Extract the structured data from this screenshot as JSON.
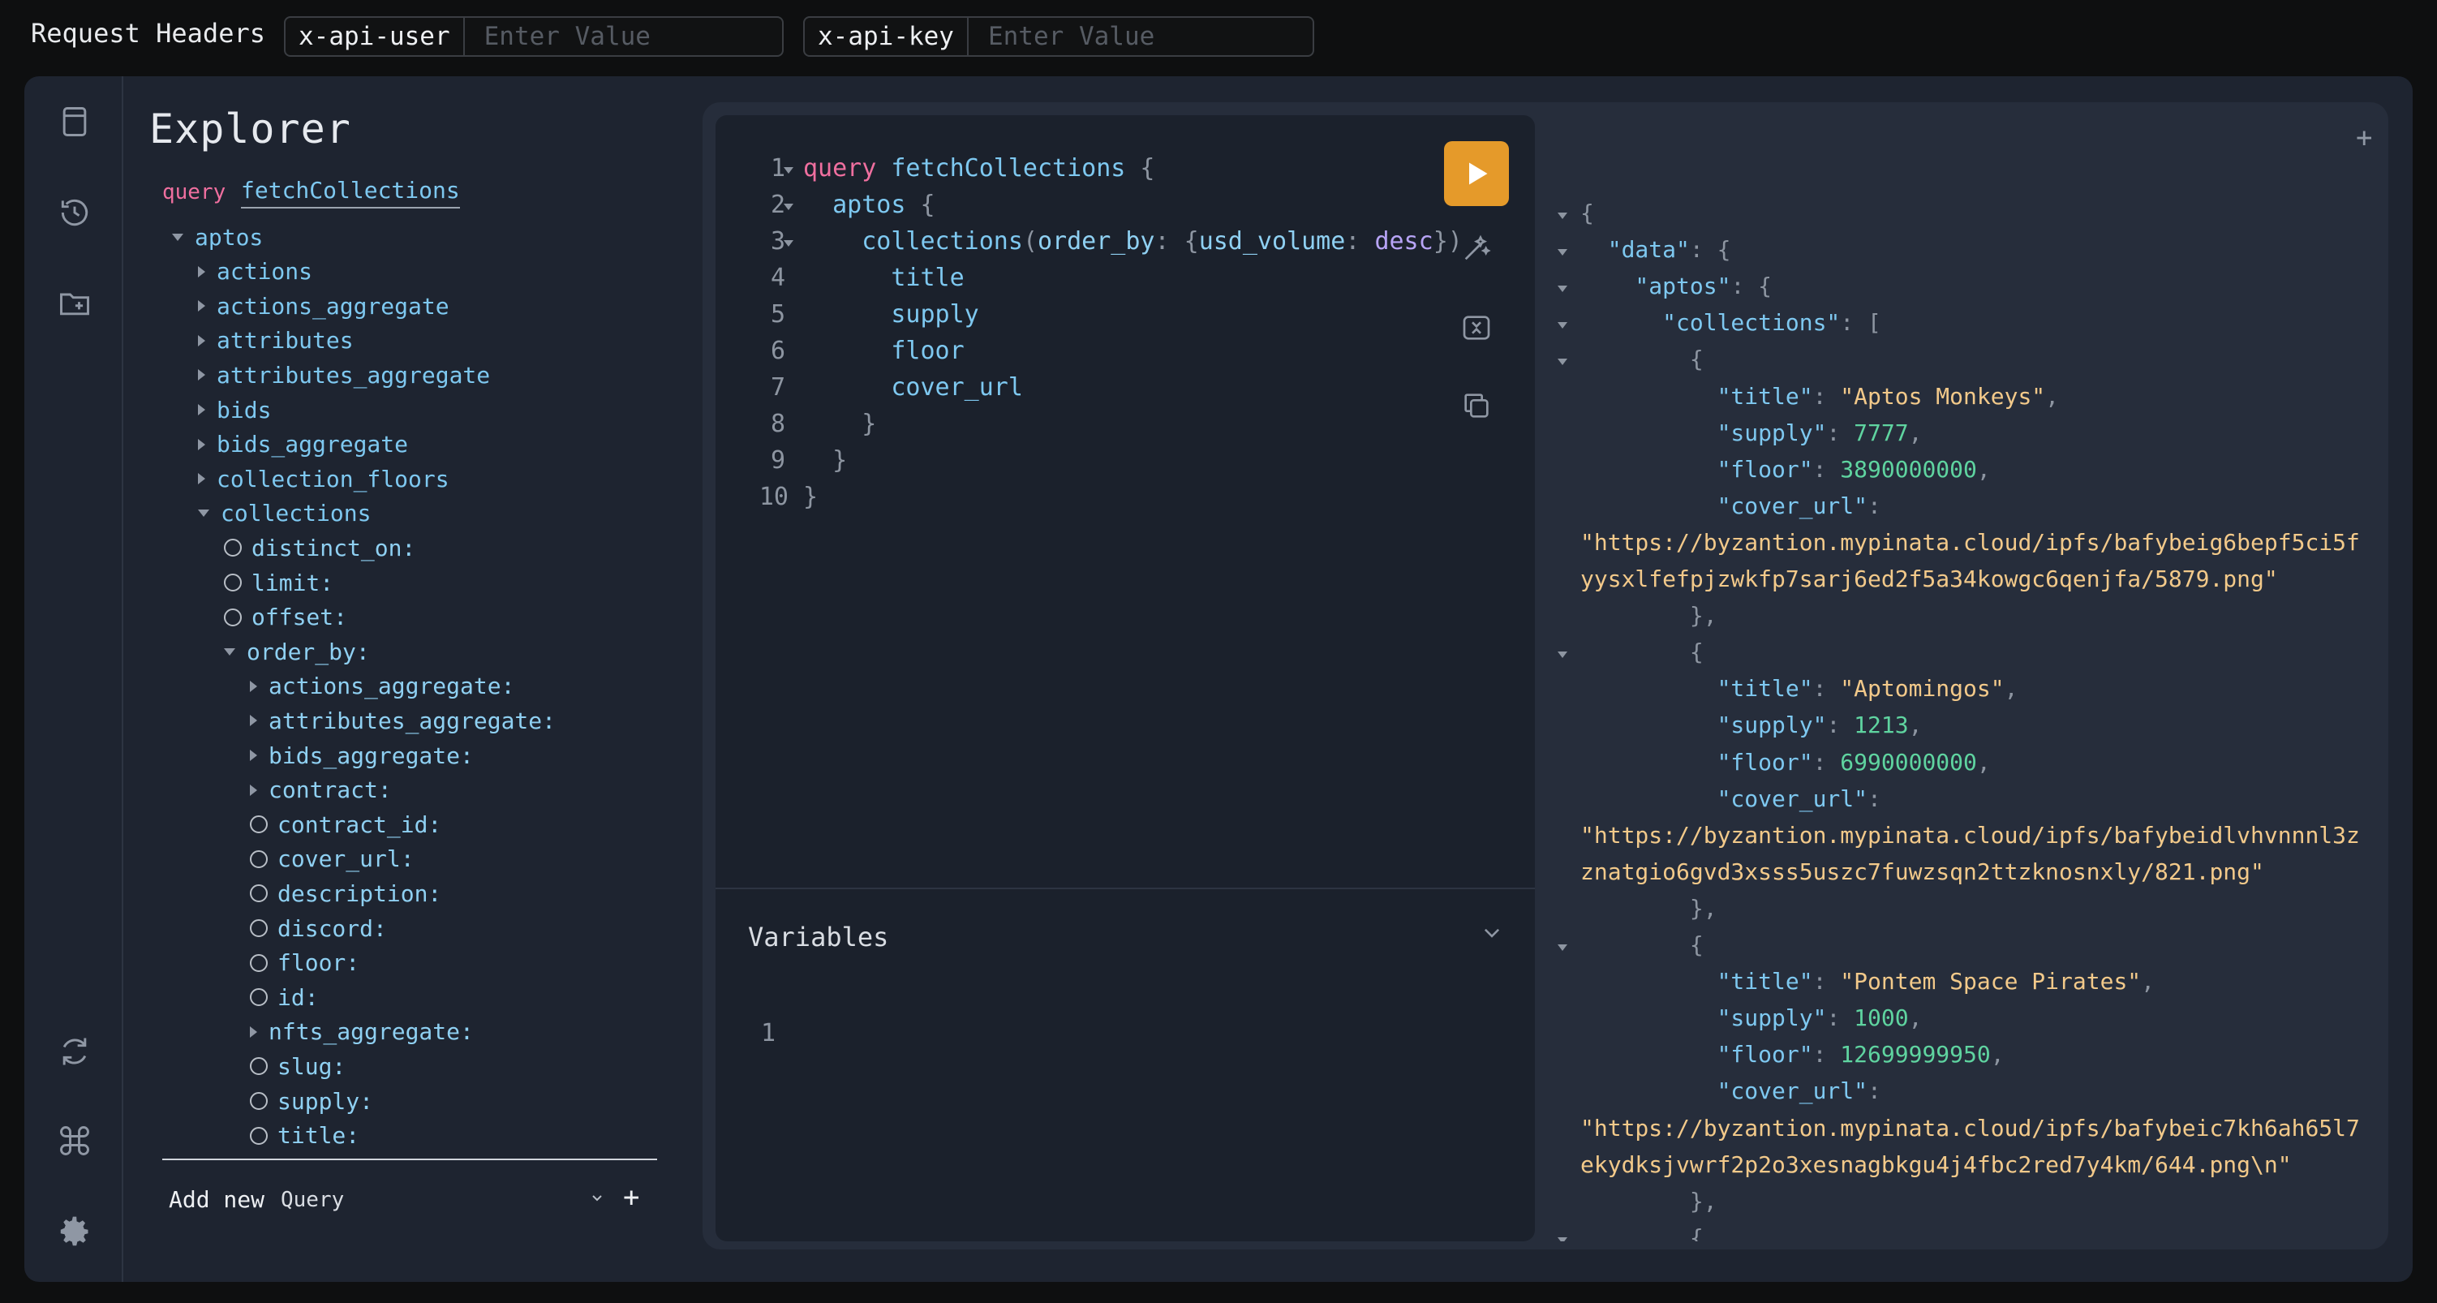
{
  "header": {
    "title": "Request Headers",
    "fields": [
      {
        "key": "x-api-user",
        "placeholder": "Enter Value"
      },
      {
        "key": "x-api-key",
        "placeholder": "Enter Value"
      }
    ]
  },
  "rail": {
    "top_icons": [
      "document-icon",
      "history-icon",
      "folder-add-icon"
    ],
    "bottom_icons": [
      "refresh-icon",
      "command-icon",
      "gear-icon"
    ]
  },
  "explorer": {
    "title": "Explorer",
    "operation_keyword": "query",
    "operation_name": "fetchCollections",
    "tree": [
      {
        "label": "aptos",
        "kind": "field",
        "state": "expanded",
        "depth": 0
      },
      {
        "label": "actions",
        "kind": "field",
        "state": "collapsed",
        "depth": 1
      },
      {
        "label": "actions_aggregate",
        "kind": "field",
        "state": "collapsed",
        "depth": 1
      },
      {
        "label": "attributes",
        "kind": "field",
        "state": "collapsed",
        "depth": 1
      },
      {
        "label": "attributes_aggregate",
        "kind": "field",
        "state": "collapsed",
        "depth": 1
      },
      {
        "label": "bids",
        "kind": "field",
        "state": "collapsed",
        "depth": 1
      },
      {
        "label": "bids_aggregate",
        "kind": "field",
        "state": "collapsed",
        "depth": 1
      },
      {
        "label": "collection_floors",
        "kind": "field",
        "state": "collapsed",
        "depth": 1
      },
      {
        "label": "collections",
        "kind": "field",
        "state": "expanded",
        "depth": 1
      },
      {
        "label": "distinct_on:",
        "kind": "arg",
        "state": "radio",
        "depth": 2
      },
      {
        "label": "limit:",
        "kind": "arg",
        "state": "radio",
        "depth": 2
      },
      {
        "label": "offset:",
        "kind": "arg",
        "state": "radio",
        "depth": 2
      },
      {
        "label": "order_by:",
        "kind": "arg",
        "state": "expanded",
        "depth": 2
      },
      {
        "label": "actions_aggregate:",
        "kind": "arg",
        "state": "collapsed",
        "depth": 3
      },
      {
        "label": "attributes_aggregate:",
        "kind": "arg",
        "state": "collapsed",
        "depth": 3
      },
      {
        "label": "bids_aggregate:",
        "kind": "arg",
        "state": "collapsed",
        "depth": 3
      },
      {
        "label": "contract:",
        "kind": "arg",
        "state": "collapsed",
        "depth": 3
      },
      {
        "label": "contract_id:",
        "kind": "arg",
        "state": "radio",
        "depth": 3
      },
      {
        "label": "cover_url:",
        "kind": "arg",
        "state": "radio",
        "depth": 3
      },
      {
        "label": "description:",
        "kind": "arg",
        "state": "radio",
        "depth": 3
      },
      {
        "label": "discord:",
        "kind": "arg",
        "state": "radio",
        "depth": 3
      },
      {
        "label": "floor:",
        "kind": "arg",
        "state": "radio",
        "depth": 3
      },
      {
        "label": "id:",
        "kind": "arg",
        "state": "radio",
        "depth": 3
      },
      {
        "label": "nfts_aggregate:",
        "kind": "arg",
        "state": "collapsed",
        "depth": 3
      },
      {
        "label": "slug:",
        "kind": "arg",
        "state": "radio",
        "depth": 3
      },
      {
        "label": "supply:",
        "kind": "arg",
        "state": "radio",
        "depth": 3
      },
      {
        "label": "title:",
        "kind": "arg",
        "state": "radio",
        "depth": 3
      }
    ],
    "add_new_label": "Add new",
    "add_new_type": "Query",
    "add_plus": "+"
  },
  "editor": {
    "line_numbers": [
      "1",
      "2",
      "3",
      "4",
      "5",
      "6",
      "7",
      "8",
      "9",
      "10"
    ],
    "fold_lines": [
      1,
      2,
      3
    ],
    "lines": [
      [
        {
          "t": "query ",
          "c": "k"
        },
        {
          "t": "fetchCollections",
          "c": "f"
        },
        {
          "t": " {",
          "c": "p"
        }
      ],
      [
        {
          "t": "  aptos",
          "c": "f"
        },
        {
          "t": " {",
          "c": "p"
        }
      ],
      [
        {
          "t": "    collections",
          "c": "f"
        },
        {
          "t": "(",
          "c": "p"
        },
        {
          "t": "order_by",
          "c": "a"
        },
        {
          "t": ": {",
          "c": "p"
        },
        {
          "t": "usd_volume",
          "c": "a"
        },
        {
          "t": ": ",
          "c": "p"
        },
        {
          "t": "desc",
          "c": "e"
        },
        {
          "t": "})",
          "c": "p"
        }
      ],
      [
        {
          "t": "      title",
          "c": "f"
        }
      ],
      [
        {
          "t": "      supply",
          "c": "f"
        }
      ],
      [
        {
          "t": "      floor",
          "c": "f"
        }
      ],
      [
        {
          "t": "      cover_url",
          "c": "f"
        }
      ],
      [
        {
          "t": "    }",
          "c": "p"
        }
      ],
      [
        {
          "t": "  }",
          "c": "p"
        }
      ],
      [
        {
          "t": "}",
          "c": "p"
        }
      ]
    ],
    "variables_title": "Variables",
    "variables_line": "1"
  },
  "result": {
    "plus": "+",
    "lines": [
      {
        "fold": true,
        "parts": [
          {
            "t": "{",
            "c": "jp"
          }
        ]
      },
      {
        "fold": true,
        "parts": [
          {
            "t": "  \"data\"",
            "c": "jk"
          },
          {
            "t": ": {",
            "c": "jp"
          }
        ]
      },
      {
        "fold": true,
        "parts": [
          {
            "t": "    \"aptos\"",
            "c": "jk"
          },
          {
            "t": ": {",
            "c": "jp"
          }
        ]
      },
      {
        "fold": true,
        "parts": [
          {
            "t": "      \"collections\"",
            "c": "jk"
          },
          {
            "t": ": [",
            "c": "jp"
          }
        ]
      },
      {
        "fold": true,
        "parts": [
          {
            "t": "        {",
            "c": "jp"
          }
        ]
      },
      {
        "fold": false,
        "parts": [
          {
            "t": "          \"title\"",
            "c": "jk"
          },
          {
            "t": ": ",
            "c": "jp"
          },
          {
            "t": "\"Aptos Monkeys\"",
            "c": "js"
          },
          {
            "t": ",",
            "c": "jp"
          }
        ]
      },
      {
        "fold": false,
        "parts": [
          {
            "t": "          \"supply\"",
            "c": "jk"
          },
          {
            "t": ": ",
            "c": "jp"
          },
          {
            "t": "7777",
            "c": "jn"
          },
          {
            "t": ",",
            "c": "jp"
          }
        ]
      },
      {
        "fold": false,
        "parts": [
          {
            "t": "          \"floor\"",
            "c": "jk"
          },
          {
            "t": ": ",
            "c": "jp"
          },
          {
            "t": "3890000000",
            "c": "jn"
          },
          {
            "t": ",",
            "c": "jp"
          }
        ]
      },
      {
        "fold": false,
        "parts": [
          {
            "t": "          \"cover_url\"",
            "c": "jk"
          },
          {
            "t": ":",
            "c": "jp"
          }
        ]
      },
      {
        "fold": false,
        "parts": [
          {
            "t": "\"https://byzantion.mypinata.cloud/ipfs/bafybeig6bepf5ci5f",
            "c": "js"
          }
        ]
      },
      {
        "fold": false,
        "parts": [
          {
            "t": "yysxlfefpjzwkfp7sarj6ed2f5a34kowgc6qenjfa/5879.png\"",
            "c": "js"
          }
        ]
      },
      {
        "fold": false,
        "parts": [
          {
            "t": "        },",
            "c": "jp"
          }
        ]
      },
      {
        "fold": true,
        "parts": [
          {
            "t": "        {",
            "c": "jp"
          }
        ]
      },
      {
        "fold": false,
        "parts": [
          {
            "t": "          \"title\"",
            "c": "jk"
          },
          {
            "t": ": ",
            "c": "jp"
          },
          {
            "t": "\"Aptomingos\"",
            "c": "js"
          },
          {
            "t": ",",
            "c": "jp"
          }
        ]
      },
      {
        "fold": false,
        "parts": [
          {
            "t": "          \"supply\"",
            "c": "jk"
          },
          {
            "t": ": ",
            "c": "jp"
          },
          {
            "t": "1213",
            "c": "jn"
          },
          {
            "t": ",",
            "c": "jp"
          }
        ]
      },
      {
        "fold": false,
        "parts": [
          {
            "t": "          \"floor\"",
            "c": "jk"
          },
          {
            "t": ": ",
            "c": "jp"
          },
          {
            "t": "6990000000",
            "c": "jn"
          },
          {
            "t": ",",
            "c": "jp"
          }
        ]
      },
      {
        "fold": false,
        "parts": [
          {
            "t": "          \"cover_url\"",
            "c": "jk"
          },
          {
            "t": ":",
            "c": "jp"
          }
        ]
      },
      {
        "fold": false,
        "parts": [
          {
            "t": "\"https://byzantion.mypinata.cloud/ipfs/bafybeidlvhvnnnl3z",
            "c": "js"
          }
        ]
      },
      {
        "fold": false,
        "parts": [
          {
            "t": "znatgio6gvd3xsss5uszc7fuwzsqn2ttzknosnxly/821.png\"",
            "c": "js"
          }
        ]
      },
      {
        "fold": false,
        "parts": [
          {
            "t": "        },",
            "c": "jp"
          }
        ]
      },
      {
        "fold": true,
        "parts": [
          {
            "t": "        {",
            "c": "jp"
          }
        ]
      },
      {
        "fold": false,
        "parts": [
          {
            "t": "          \"title\"",
            "c": "jk"
          },
          {
            "t": ": ",
            "c": "jp"
          },
          {
            "t": "\"Pontem Space Pirates\"",
            "c": "js"
          },
          {
            "t": ",",
            "c": "jp"
          }
        ]
      },
      {
        "fold": false,
        "parts": [
          {
            "t": "          \"supply\"",
            "c": "jk"
          },
          {
            "t": ": ",
            "c": "jp"
          },
          {
            "t": "1000",
            "c": "jn"
          },
          {
            "t": ",",
            "c": "jp"
          }
        ]
      },
      {
        "fold": false,
        "parts": [
          {
            "t": "          \"floor\"",
            "c": "jk"
          },
          {
            "t": ": ",
            "c": "jp"
          },
          {
            "t": "12699999950",
            "c": "jn"
          },
          {
            "t": ",",
            "c": "jp"
          }
        ]
      },
      {
        "fold": false,
        "parts": [
          {
            "t": "          \"cover_url\"",
            "c": "jk"
          },
          {
            "t": ":",
            "c": "jp"
          }
        ]
      },
      {
        "fold": false,
        "parts": [
          {
            "t": "\"https://byzantion.mypinata.cloud/ipfs/bafybeic7kh6ah65l7",
            "c": "js"
          }
        ]
      },
      {
        "fold": false,
        "parts": [
          {
            "t": "ekydksjvwrf2p2o3xesnagbkgu4j4fbc2red7y4km/644.png\\n\"",
            "c": "js"
          }
        ]
      },
      {
        "fold": false,
        "parts": [
          {
            "t": "        },",
            "c": "jp"
          }
        ]
      },
      {
        "fold": true,
        "parts": [
          {
            "t": "        {",
            "c": "jp"
          }
        ]
      }
    ]
  },
  "colors": {
    "run_button": "#e59a2a",
    "keyword": "#ef6f9f",
    "field": "#7ec8f0",
    "string": "#f2c98a",
    "number": "#5fd4a0",
    "enum": "#b7a4f6"
  }
}
